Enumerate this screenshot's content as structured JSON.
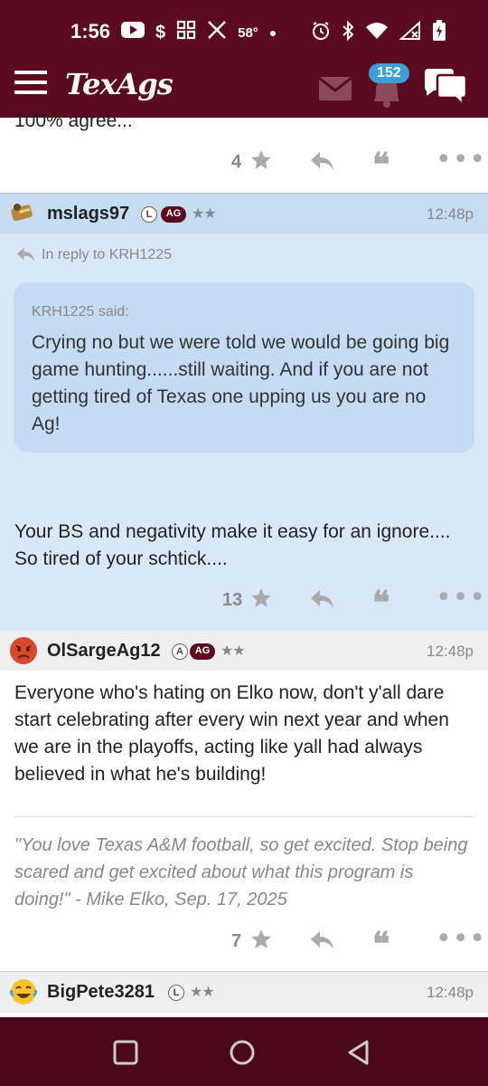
{
  "status_bar": {
    "time": "1:56",
    "temperature": "58°",
    "icons_left": [
      "youtube-icon",
      "dollar-icon",
      "grid-app-icon",
      "x-logo-icon",
      "temp-text",
      "dot-icon"
    ],
    "icons_right": [
      "alarm-icon",
      "bluetooth-icon",
      "wifi-icon",
      "signal-icon",
      "battery-charging-icon"
    ]
  },
  "header": {
    "logo": "TexAgs",
    "notification_count": "152",
    "colors": {
      "maroon": "#5c0a1e",
      "badge_blue": "#3ca0d8"
    }
  },
  "prev_post": {
    "cut_text": "100% agree...",
    "star_count": "4"
  },
  "post1": {
    "username": "mslags97",
    "badge_l": "L",
    "badge_ag": "AG",
    "stars": "★★",
    "time": "12:48p",
    "reply_to": "In reply to KRH1225",
    "quote_author": "KRH1225 said:",
    "quote_text": "Crying no but we were told we would be going big game hunting......still waiting. And if you are not getting tired of Texas one upping us you are no Ag!",
    "body": "Your BS and negativity make it easy for an ignore.... So tired of your schtick....",
    "star_count": "13"
  },
  "post2": {
    "username": "OlSargeAg12",
    "badge_a": "A",
    "badge_ag": "AG",
    "stars": "★★",
    "time": "12:48p",
    "body": "Everyone who's hating on Elko now, don't y'all dare start celebrating after every win next year and when we are in the playoffs, acting like yall had always believed in what he's building!",
    "signature": "\"You love Texas A&M football, so get excited. Stop being scared and get excited about what this program is doing!\" - Mike Elko, Sep. 17, 2025",
    "star_count": "7"
  },
  "post3": {
    "username": "BigPete3281",
    "badge_l": "L",
    "stars": "★★",
    "time": "12:48p"
  },
  "actions": {
    "quote_glyph": "❝",
    "more_glyph": "•••"
  }
}
